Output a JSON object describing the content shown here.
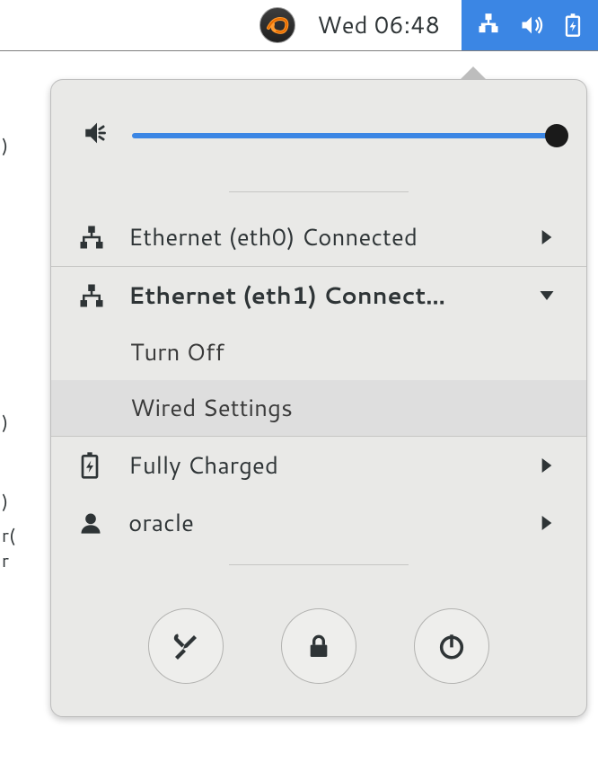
{
  "top_panel": {
    "clock": "Wed 06:48"
  },
  "popup": {
    "volume": {
      "level": 100
    },
    "rows": {
      "eth0": {
        "label": "Ethernet (eth0) Connected"
      },
      "eth1": {
        "label": "Ethernet (eth1) Connect…",
        "sub_turn_off": "Turn Off",
        "sub_wired_settings": "Wired Settings"
      },
      "battery": {
        "label": "Fully Charged"
      },
      "user": {
        "label": "oracle"
      }
    }
  }
}
